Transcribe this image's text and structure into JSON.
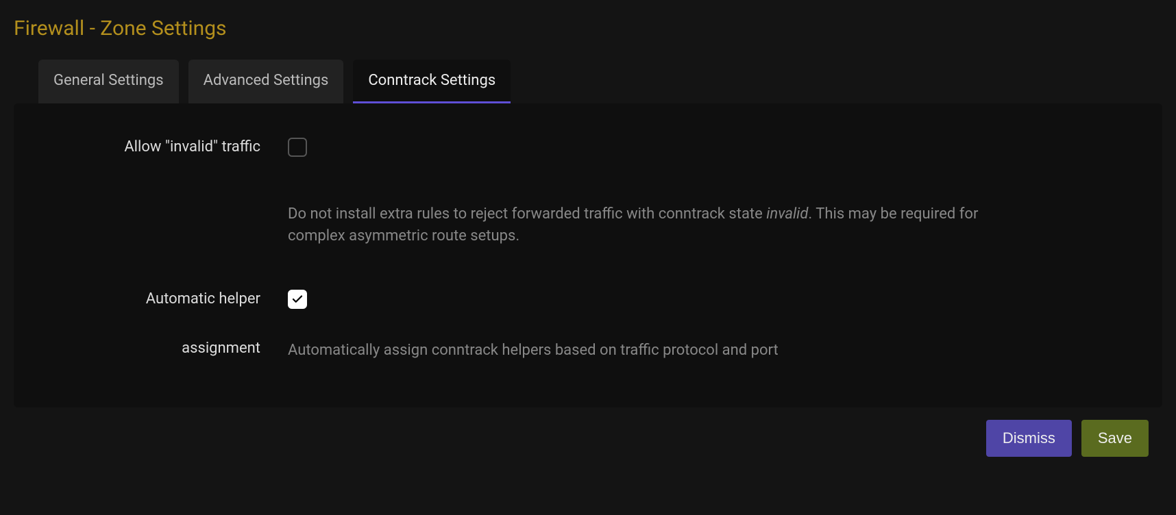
{
  "title": "Firewall - Zone Settings",
  "tabs": {
    "general": "General Settings",
    "advanced": "Advanced Settings",
    "conntrack": "Conntrack Settings"
  },
  "fields": {
    "allow_invalid": {
      "label": "Allow \"invalid\" traffic",
      "checked": false,
      "desc_pre": "Do not install extra rules to reject forwarded traffic with conntrack state ",
      "desc_em": "invalid",
      "desc_post": ". This may be required for complex asymmetric route setups."
    },
    "auto_helper": {
      "label_line1": "Automatic helper",
      "label_line2": "assignment",
      "checked": true,
      "desc": "Automatically assign conntrack helpers based on traffic protocol and port"
    }
  },
  "buttons": {
    "dismiss": "Dismiss",
    "save": "Save"
  }
}
